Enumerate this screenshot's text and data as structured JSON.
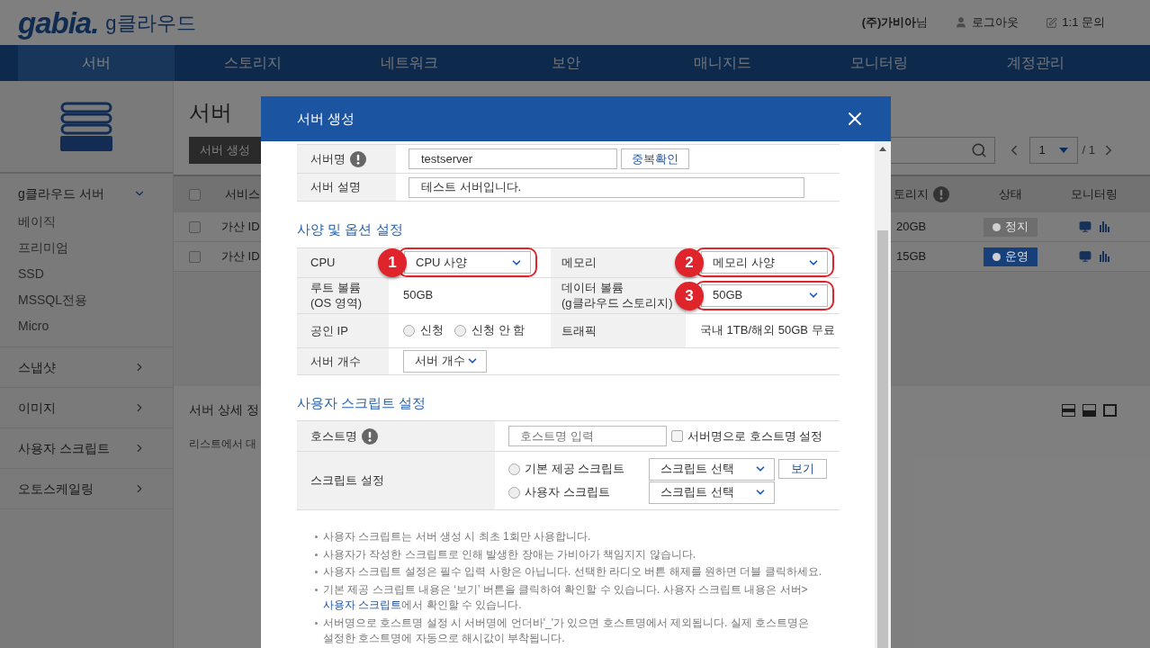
{
  "header": {
    "logo": "gabia.",
    "product": "g클라우드",
    "user": "**(주)가비아**님",
    "logout": "로그아웃",
    "inquiry": "1:1 문의"
  },
  "nav": [
    {
      "label": "서버",
      "selected": true
    },
    {
      "label": "스토리지",
      "selected": false
    },
    {
      "label": "네트워크",
      "selected": false
    },
    {
      "label": "보안",
      "selected": false
    },
    {
      "label": "매니지드",
      "selected": false
    },
    {
      "label": "모니터링",
      "selected": false
    },
    {
      "label": "계정관리",
      "selected": false
    }
  ],
  "sidebar": [
    {
      "label": "g클라우드 서버",
      "expanded": true,
      "children": [
        {
          "label": "베이직"
        },
        {
          "label": "프리미엄"
        },
        {
          "label": "SSD"
        },
        {
          "label": "MSSQL전용"
        },
        {
          "label": "Micro"
        }
      ]
    },
    {
      "label": "스냅샷",
      "expanded": false
    },
    {
      "label": "이미지",
      "expanded": false
    },
    {
      "label": "사용자 스크립트",
      "expanded": false
    },
    {
      "label": "오토스케일링",
      "expanded": false
    }
  ],
  "page": {
    "title": "서버",
    "create_button": "서버 생성",
    "page_select": "1",
    "page_total": "/ 1"
  },
  "table": {
    "header_checked": false,
    "columns": [
      "서비스",
      "토리지",
      "상태",
      "모니터링"
    ],
    "rows": [
      {
        "checked": false,
        "location": "가산 ID",
        "storage": "20GB",
        "status": {
          "label": "정지",
          "color": "#6e6e6e"
        }
      },
      {
        "checked": false,
        "location": "가산 ID",
        "storage": "15GB",
        "status": {
          "label": "운영",
          "color": "#173f7a"
        }
      }
    ]
  },
  "detail": {
    "title": "서버 상세 정",
    "hint": "리스트에서 대"
  },
  "modal": {
    "title": "서버 생성",
    "basic": [
      {
        "label": "서버명",
        "info": true,
        "value": "testserver",
        "button": "중복확인"
      },
      {
        "label": "서버 설명",
        "info": false,
        "value": "테스트 서버입니다."
      }
    ],
    "spec_title": "사양 및 옵션 설정",
    "spec_rows": [
      [
        {
          "label": [
            "CPU"
          ],
          "kind": "select",
          "value": "CPU 사양",
          "marker": "1"
        },
        {
          "label": [
            "메모리"
          ],
          "kind": "select",
          "value": "메모리 사양",
          "marker": "2"
        }
      ],
      [
        {
          "label": [
            "루트 볼륨",
            "(OS 영역)"
          ],
          "kind": "text",
          "value": "50GB"
        },
        {
          "label": [
            "데이터 볼륨",
            "(g클라우드 스토리지)"
          ],
          "kind": "select",
          "value": "50GB",
          "marker": "3"
        }
      ],
      [
        {
          "label": [
            "공인 IP"
          ],
          "kind": "radios",
          "options": [
            {
              "label": "신청",
              "selected": false
            },
            {
              "label": "신청 안 함",
              "selected": false
            }
          ]
        },
        {
          "label": [
            "트래픽"
          ],
          "kind": "text",
          "value": "국내 1TB/해외 50GB 무료"
        }
      ],
      [
        {
          "label": [
            "서버 개수"
          ],
          "kind": "dropdown",
          "value": "서버 개수"
        }
      ]
    ],
    "script_title": "사용자 스크립트 설정",
    "hostname": {
      "label": "호스트명",
      "info": true,
      "placeholder": "호스트명 입력",
      "checkbox": {
        "label": "서버명으로 호스트명 설정",
        "checked": false
      }
    },
    "script": {
      "label": "스크립트 설정",
      "options": [
        {
          "label": "기본 제공 스크립트",
          "selected": false,
          "select": "스크립트 선택",
          "button": "보기"
        },
        {
          "label": "사용자 스크립트",
          "selected": false,
          "select": "스크립트 선택"
        }
      ]
    },
    "notes": [
      [
        {
          "text": "사용자 스크립트는 서버 생성 시 최초 1회만 사용합니다.",
          "link": false
        }
      ],
      [
        {
          "text": "사용자가 작성한 스크립트로 인해 발생한 장애는 가비아가 책임지지 않습니다.",
          "link": false
        }
      ],
      [
        {
          "text": "사용자 스크립트 설정은 필수 입력 사항은 아닙니다. 선택한 라디오 버튼 해제를 원하면 더블 클릭하세요.",
          "link": false
        }
      ],
      [
        {
          "text": "기본 제공 스크립트 내용은 ‘보기’ 버튼을 클릭하여 확인할 수 있습니다. 사용자 스크립트 내용은 서버> ",
          "link": false
        },
        {
          "text": "사용자 스크립트",
          "link": true
        },
        {
          "text": "에서 확인할 수 있습니다.",
          "link": false
        }
      ],
      [
        {
          "text": "서버명으로 호스트명 설정 시 서버명에 언더바'_'가 있으면 호스트명에서 제외됩니다. 실제 호스트명은 설정한 호스트명에 자동으로 해시값이 부착됩니다.",
          "link": false
        }
      ]
    ]
  }
}
